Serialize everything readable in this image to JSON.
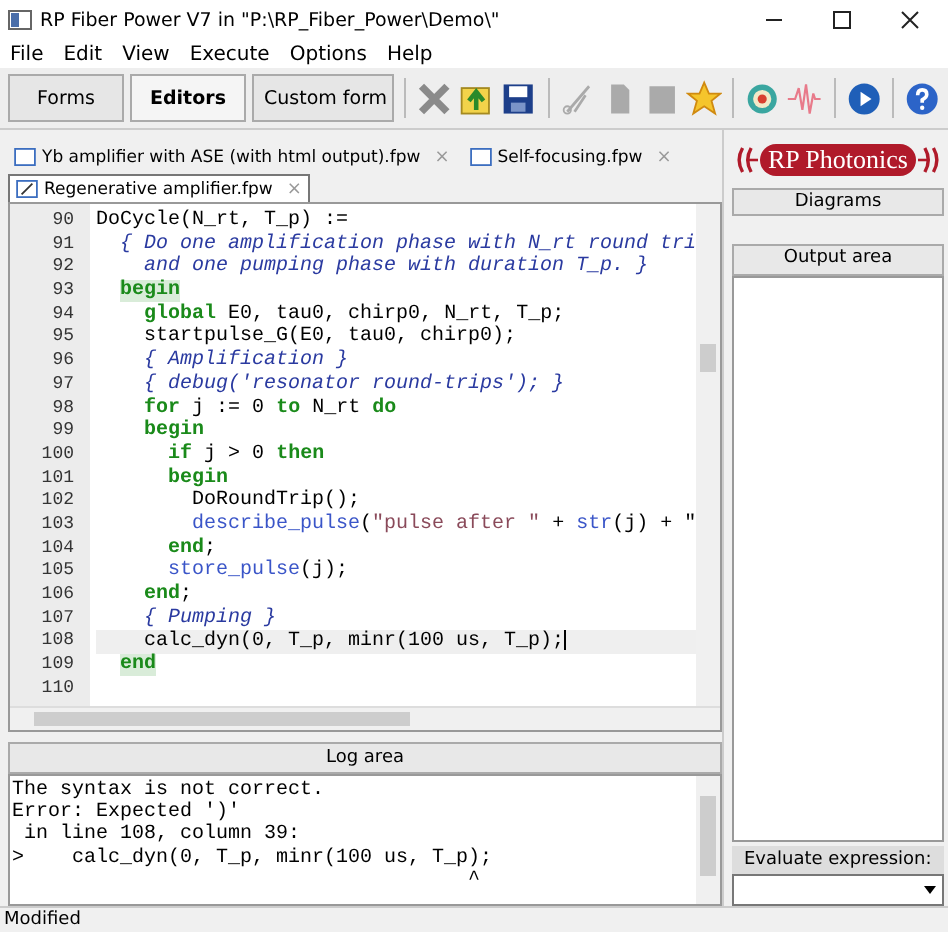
{
  "window": {
    "title": "RP Fiber Power V7 in \"P:\\RP_Fiber_Power\\Demo\\\""
  },
  "menu": [
    "File",
    "Edit",
    "View",
    "Execute",
    "Options",
    "Help"
  ],
  "mode_buttons": [
    {
      "label": "Forms",
      "selected": false
    },
    {
      "label": "Editors",
      "selected": true
    },
    {
      "label": "Custom form",
      "selected": false
    }
  ],
  "file_tabs": [
    {
      "label": "Yb amplifier with ASE (with html output).fpw",
      "close": "×",
      "selected": false
    },
    {
      "label": "Self-focusing.fpw",
      "close": "×",
      "selected": false
    },
    {
      "label": "Regenerative amplifier.fpw",
      "close": "×",
      "selected": true
    }
  ],
  "editor": {
    "lines": [
      {
        "number": "90",
        "current": false,
        "segments": [
          {
            "kind": "plain",
            "text": "DoCycle(N_rt, T_p) :="
          }
        ]
      },
      {
        "number": "91",
        "current": false,
        "segments": [
          {
            "kind": "comment",
            "text": "  { Do one amplification phase with N_rt round tri"
          }
        ]
      },
      {
        "number": "92",
        "current": false,
        "segments": [
          {
            "kind": "comment",
            "text": "    and one pumping phase with duration T_p. }"
          }
        ]
      },
      {
        "number": "93",
        "current": false,
        "segments": [
          {
            "kind": "match",
            "text": "  begin"
          }
        ]
      },
      {
        "number": "94",
        "current": false,
        "segments": [
          {
            "kind": "keyword",
            "text": "    global"
          },
          {
            "kind": "plain",
            "text": " E0, tau0, chirp0, N_rt, T_p;"
          }
        ]
      },
      {
        "number": "95",
        "current": false,
        "segments": [
          {
            "kind": "plain",
            "text": "    startpulse_G(E0, tau0, chirp0);"
          }
        ]
      },
      {
        "number": "96",
        "current": false,
        "segments": [
          {
            "kind": "comment",
            "text": "    { Amplification }"
          }
        ]
      },
      {
        "number": "97",
        "current": false,
        "segments": [
          {
            "kind": "comment",
            "text": "    { debug('resonator round-trips'); }"
          }
        ]
      },
      {
        "number": "98",
        "current": false,
        "segments": [
          {
            "kind": "keyword",
            "text": "    for"
          },
          {
            "kind": "plain",
            "text": " j := 0 "
          },
          {
            "kind": "keyword",
            "text": "to"
          },
          {
            "kind": "plain",
            "text": " N_rt "
          },
          {
            "kind": "keyword",
            "text": "do"
          }
        ]
      },
      {
        "number": "99",
        "current": false,
        "segments": [
          {
            "kind": "keyword",
            "text": "    begin"
          }
        ]
      },
      {
        "number": "100",
        "current": false,
        "segments": [
          {
            "kind": "keyword",
            "text": "      if"
          },
          {
            "kind": "plain",
            "text": " j > 0 "
          },
          {
            "kind": "keyword",
            "text": "then"
          }
        ]
      },
      {
        "number": "101",
        "current": false,
        "segments": [
          {
            "kind": "keyword",
            "text": "      begin"
          }
        ]
      },
      {
        "number": "102",
        "current": false,
        "segments": [
          {
            "kind": "plain",
            "text": "        DoRoundTrip();"
          }
        ]
      },
      {
        "number": "103",
        "current": false,
        "segments": [
          {
            "kind": "function",
            "text": "        describe_pulse"
          },
          {
            "kind": "plain",
            "text": "("
          },
          {
            "kind": "string",
            "text": "\"pulse after \""
          },
          {
            "kind": "plain",
            "text": " + "
          },
          {
            "kind": "function",
            "text": "str"
          },
          {
            "kind": "plain",
            "text": "(j) + \""
          }
        ]
      },
      {
        "number": "104",
        "current": false,
        "segments": [
          {
            "kind": "keyword",
            "text": "      end"
          },
          {
            "kind": "plain",
            "text": ";"
          }
        ]
      },
      {
        "number": "105",
        "current": false,
        "segments": [
          {
            "kind": "function",
            "text": "      store_pulse"
          },
          {
            "kind": "plain",
            "text": "(j);"
          }
        ]
      },
      {
        "number": "106",
        "current": false,
        "segments": [
          {
            "kind": "keyword",
            "text": "    end"
          },
          {
            "kind": "plain",
            "text": ";"
          }
        ]
      },
      {
        "number": "107",
        "current": false,
        "segments": [
          {
            "kind": "comment",
            "text": "    { Pumping }"
          }
        ]
      },
      {
        "number": "108",
        "current": true,
        "segments": [
          {
            "kind": "plain",
            "text": "    calc_dyn(0, T_p, minr(100 us, T_p);"
          }
        ]
      },
      {
        "number": "109",
        "current": false,
        "segments": [
          {
            "kind": "match",
            "text": "  end"
          }
        ]
      },
      {
        "number": "110",
        "current": false
      }
    ]
  },
  "log": {
    "header": "Log area",
    "lines": [
      "The syntax is not correct.",
      "Error: Expected ')'",
      " in line 108, column 39:",
      ">    calc_dyn(0, T_p, minr(100 us, T_p);",
      "                                      ^"
    ]
  },
  "right_panel": {
    "logo": "RP Photonics",
    "diagrams_button": "Diagrams",
    "output_header": "Output area",
    "evaluate_label": "Evaluate expression:"
  },
  "status_bar": "Modified"
}
